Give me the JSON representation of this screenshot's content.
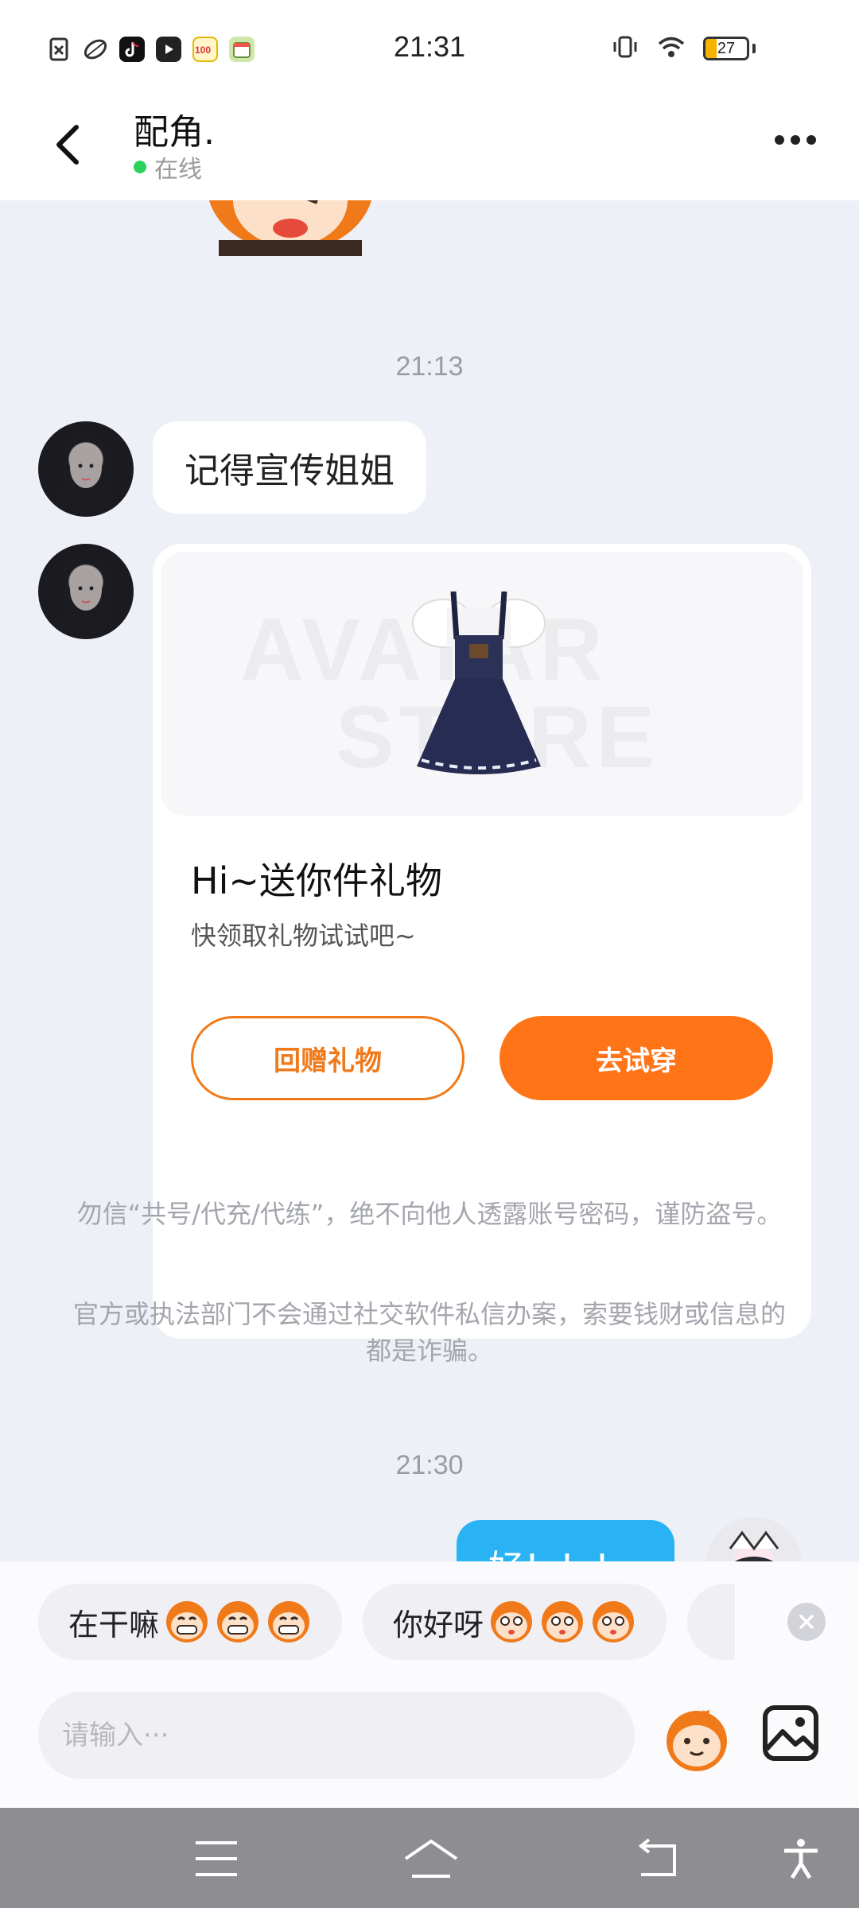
{
  "status_bar": {
    "time": "21:31",
    "battery_level": "27",
    "battery_fraction": 0.27,
    "app_icons": [
      "sim-off-icon",
      "leaf-app-icon",
      "tiktok-icon",
      "video-play-icon",
      "score-100-icon",
      "calendar-app-icon"
    ],
    "right_icons": [
      "vibrate-icon",
      "wifi-icon",
      "battery-icon"
    ]
  },
  "header": {
    "title": "配角.",
    "status": "在线",
    "back_icon": "chevron-left-icon",
    "more_icon": "more-dots-icon"
  },
  "chat": {
    "timestamp_1": "21:13",
    "message_1": "记得宣传姐姐",
    "gift_card": {
      "watermark_line1": "AVATAR",
      "watermark_line2": "STORE",
      "title": "Hi~送你件礼物",
      "subtitle": "快领取礼物试试吧~",
      "return_gift_label": "回赠礼物",
      "try_on_label": "去试穿"
    },
    "notice_1": "勿信“共号/代充/代练”，绝不向他人透露账号密码，谨防盗号。",
    "notice_2": "官方或执法部门不会通过社交软件私信办案，索要钱财或信息的都是诈骗。",
    "timestamp_2": "21:30",
    "my_message_partial": "好！！！"
  },
  "quick_replies": [
    {
      "label": "在干嘛",
      "emoji": "grinning-monkey-icon"
    },
    {
      "label": "你好呀",
      "emoji": "surprised-monkey-icon"
    }
  ],
  "input": {
    "placeholder": "请输入···"
  },
  "colors": {
    "accent_orange": "#ff7417",
    "bubble_blue": "#2ab3f4",
    "online_green": "#2bd35a"
  },
  "nav_icons": [
    "menu-icon",
    "home-icon",
    "back-nav-icon",
    "accessibility-icon"
  ]
}
